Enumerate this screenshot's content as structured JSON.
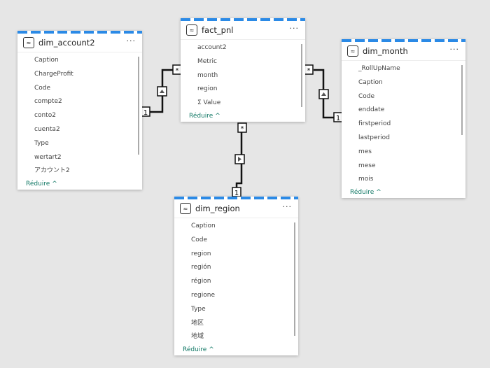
{
  "tables": [
    {
      "name": "dim_account2",
      "fields": [
        "Caption",
        "ChargeProfit",
        "Code",
        "compte2",
        "conto2",
        "cuenta2",
        "Type",
        "wertart2",
        "アカウント2"
      ],
      "collapse": "Réduire ^"
    },
    {
      "name": "fact_pnl",
      "fields": [
        "account2",
        "Metric",
        "month",
        "region",
        "Σ  Value"
      ],
      "collapse": "Réduire ^"
    },
    {
      "name": "dim_month",
      "fields": [
        "_RollUpName",
        "Caption",
        "Code",
        "enddate",
        "firstperiod",
        "lastperiod",
        "mes",
        "mese",
        "mois"
      ],
      "collapse": "Réduire ^"
    },
    {
      "name": "dim_region",
      "fields": [
        "Caption",
        "Code",
        "region",
        "región",
        "région",
        "regione",
        "Type",
        "地区",
        "地域"
      ],
      "collapse": "Réduire ^"
    }
  ],
  "more": "···",
  "relationships": [
    {
      "from": "dim_account2",
      "to": "fact_pnl",
      "one": "1",
      "many": "*"
    },
    {
      "from": "dim_month",
      "to": "fact_pnl",
      "one": "1",
      "many": "*"
    },
    {
      "from": "dim_region",
      "to": "fact_pnl",
      "one": "1",
      "many": "*"
    }
  ],
  "colors": {
    "accent": "#2b8ae6",
    "link": "#117865"
  }
}
